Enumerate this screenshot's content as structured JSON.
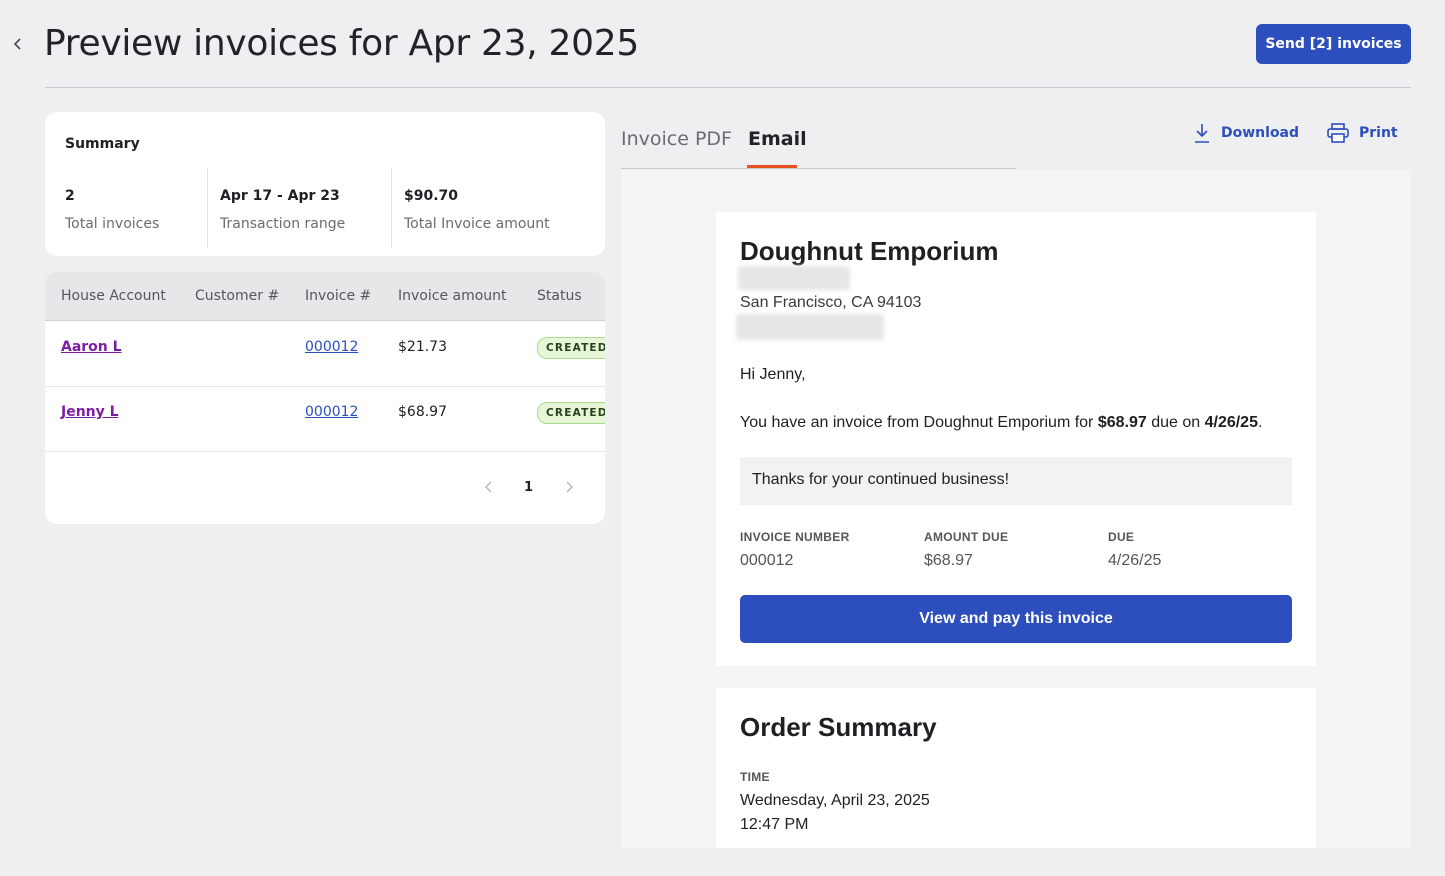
{
  "header": {
    "title": "Preview invoices for Apr 23, 2025",
    "send_label": "Send [2] invoices"
  },
  "summary": {
    "title": "Summary",
    "stats": [
      {
        "value": "2",
        "label": "Total invoices"
      },
      {
        "value": "Apr 17 - Apr 23",
        "label": "Transaction range"
      },
      {
        "value": "$90.70",
        "label": "Total Invoice amount"
      }
    ]
  },
  "table": {
    "columns": [
      "House Account",
      "Customer #",
      "Invoice #",
      "Invoice amount",
      "Status"
    ],
    "rows": [
      {
        "account": "Aaron L",
        "customer": "",
        "invoice": "000012",
        "amount": "$21.73",
        "status": "CREATED"
      },
      {
        "account": "Jenny L",
        "customer": "",
        "invoice": "000012",
        "amount": "$68.97",
        "status": "CREATED"
      }
    ],
    "pagination": {
      "current": "1"
    }
  },
  "preview": {
    "tabs": [
      {
        "label": "Invoice PDF",
        "active": false
      },
      {
        "label": "Email",
        "active": true
      }
    ],
    "actions": {
      "download": "Download",
      "print": "Print"
    },
    "email": {
      "business_name": "Doughnut Emporium",
      "address_city": "San Francisco, CA 94103",
      "greeting": "Hi Jenny,",
      "intro_prefix": "You have an invoice from Doughnut Emporium for ",
      "intro_amount": "$68.97",
      "intro_mid": " due on ",
      "intro_date": "4/26/25",
      "intro_suffix": ".",
      "note": "Thanks for your continued business!",
      "meta": [
        {
          "label": "INVOICE NUMBER",
          "value": "000012"
        },
        {
          "label": "AMOUNT DUE",
          "value": "$68.97"
        },
        {
          "label": "DUE",
          "value": "4/26/25"
        }
      ],
      "pay_button": "View and pay this invoice"
    },
    "order_summary": {
      "title": "Order Summary",
      "time_label": "TIME",
      "date": "Wednesday, April 23, 2025",
      "time": "12:47 PM"
    }
  },
  "colors": {
    "primary": "#2c4fbd",
    "tab_accent": "#e3521f",
    "badge_bg": "#e8f6d8",
    "link_account": "#7b1fa2",
    "page_bg": "#efeff1"
  },
  "icons": [
    "chevron-left-icon",
    "download-icon",
    "printer-icon",
    "chevron-right-icon"
  ]
}
